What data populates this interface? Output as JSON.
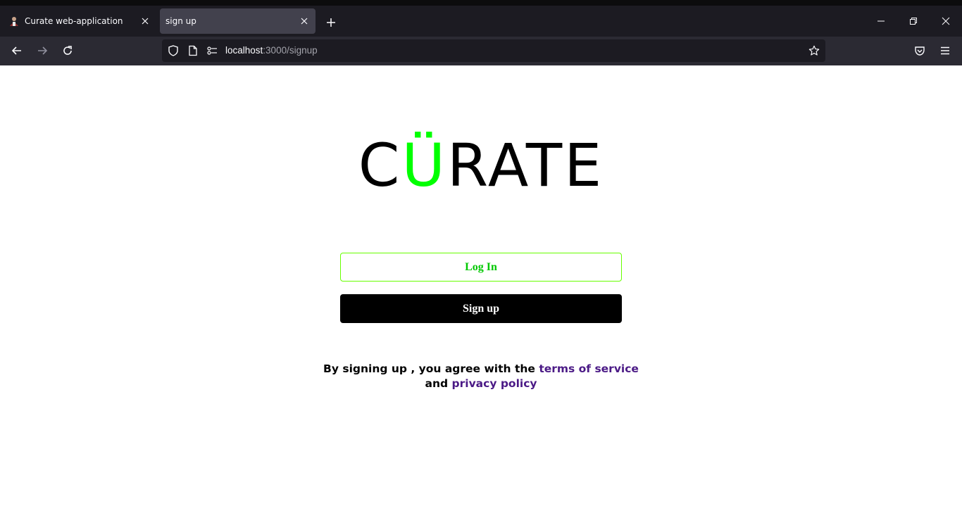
{
  "browser": {
    "tabs": [
      {
        "title": "Curate web-application",
        "active": false
      },
      {
        "title": "sign up",
        "active": true
      }
    ],
    "url": {
      "host": "localhost",
      "rest": ":3000/signup"
    }
  },
  "page": {
    "logo": {
      "part1": "C",
      "accent": "Ü",
      "part2": "RATE",
      "accent_color": "#00ff00"
    },
    "login_label": "Log In",
    "signup_label": "Sign up",
    "terms": {
      "prefix": "By signing up , you agree with the",
      "terms_link": "terms of service",
      "and": "and",
      "privacy_link": "privacy policy"
    }
  },
  "colors": {
    "chrome_dark": "#1c1b22",
    "toolbar": "#2b2a33",
    "active_tab": "#42414d",
    "login_border": "#66ff00",
    "login_text": "#00c800",
    "link": "#4b1a86"
  },
  "icons": [
    "user-favicon-icon",
    "close-icon",
    "plus-icon",
    "minimize-icon",
    "restore-icon",
    "close-window-icon",
    "back-arrow-icon",
    "forward-arrow-icon",
    "reload-icon",
    "shield-icon",
    "page-icon",
    "permissions-icon",
    "star-icon",
    "pocket-icon",
    "menu-icon"
  ]
}
